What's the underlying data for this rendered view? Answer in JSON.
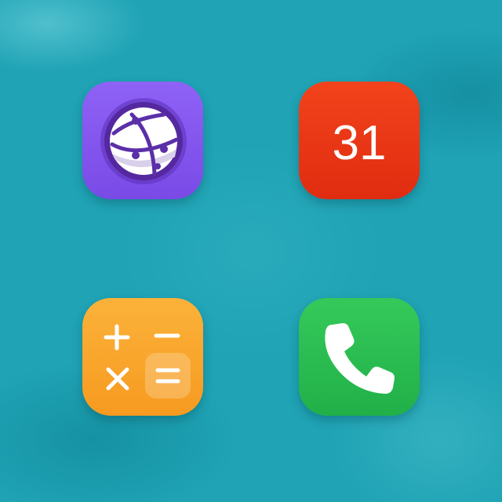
{
  "home_screen": {
    "background_color": "#1fa3b5",
    "apps": [
      {
        "id": "browser",
        "icon": "globe-icon",
        "color": "#8a5cf6"
      },
      {
        "id": "calendar",
        "icon": "calendar-icon",
        "color": "#e8361a",
        "day_number": "31"
      },
      {
        "id": "calculator",
        "icon": "calculator-icon",
        "color": "#f8a52b"
      },
      {
        "id": "phone",
        "icon": "phone-handset-icon",
        "color": "#2bbd50"
      }
    ]
  }
}
